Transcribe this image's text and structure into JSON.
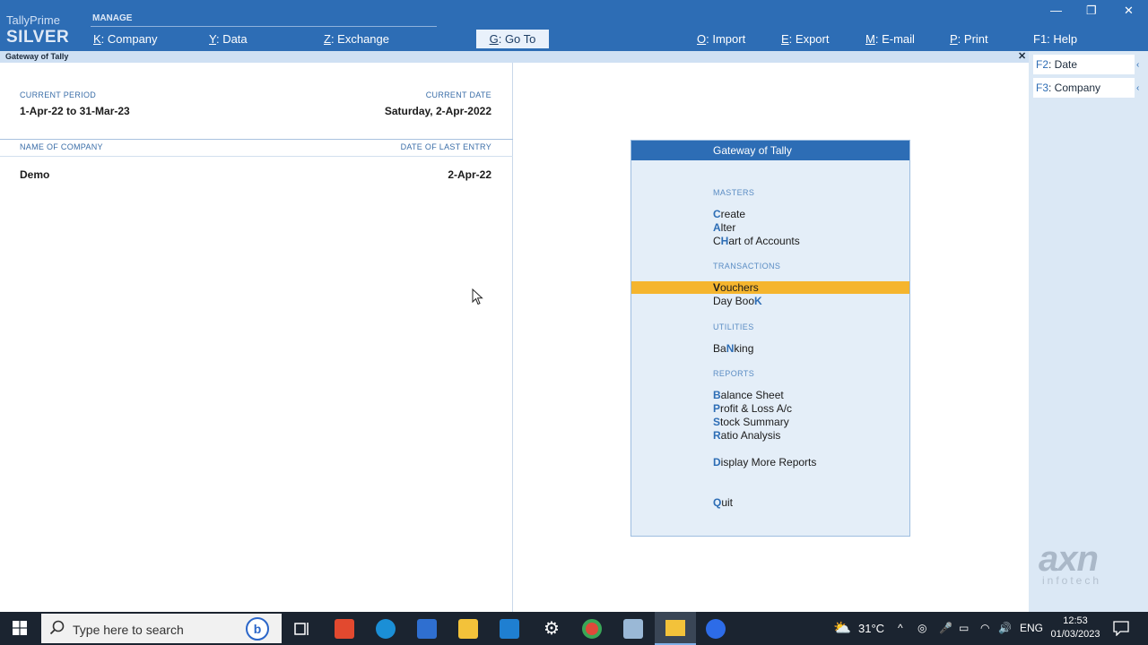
{
  "brand": {
    "product": "TallyPrime",
    "edition": "SILVER"
  },
  "topbar": {
    "manage_label": "MANAGE",
    "menu": [
      {
        "key": "K",
        "label": ": Company"
      },
      {
        "key": "Y",
        "label": ": Data"
      },
      {
        "key": "Z",
        "label": ": Exchange"
      }
    ],
    "goto": {
      "key": "G",
      "label": ": Go To"
    },
    "right_menu": [
      {
        "key": "O",
        "label": ": Import"
      },
      {
        "key": "E",
        "label": ": Export"
      },
      {
        "key": "M",
        "label": ": E-mail"
      },
      {
        "key": "P",
        "label": ": Print"
      },
      {
        "key": "F1",
        "label": ": Help"
      }
    ],
    "window_controls": {
      "minimize": "—",
      "restore": "❐",
      "close": "✕"
    }
  },
  "titlestrip": {
    "title": "Gateway of Tally",
    "close": "✕"
  },
  "info": {
    "current_period_label": "CURRENT PERIOD",
    "current_period": "1-Apr-22 to 31-Mar-23",
    "current_date_label": "CURRENT DATE",
    "current_date": "Saturday, 2-Apr-2022",
    "name_of_company_label": "NAME OF COMPANY",
    "date_of_last_entry_label": "DATE OF LAST ENTRY",
    "company_name": "Demo",
    "last_entry": "2-Apr-22"
  },
  "side_buttons": [
    {
      "key": "F2",
      "label": ": Date"
    },
    {
      "key": "F3",
      "label": ": Company"
    }
  ],
  "gateway": {
    "title": "Gateway of Tally",
    "sections": {
      "masters": "MASTERS",
      "transactions": "TRANSACTIONS",
      "utilities": "UTILITIES",
      "reports": "REPORTS"
    },
    "items": {
      "create": {
        "pre": "",
        "hk": "C",
        "post": "reate"
      },
      "alter": {
        "pre": "",
        "hk": "A",
        "post": "lter"
      },
      "chart": {
        "pre": "C",
        "hk": "H",
        "post": "art of Accounts"
      },
      "vouchers": {
        "pre": "",
        "hk": "V",
        "post": "ouchers"
      },
      "daybook": {
        "pre": "Day Boo",
        "hk": "K",
        "post": ""
      },
      "banking": {
        "pre": "Ba",
        "hk": "N",
        "post": "king"
      },
      "balance": {
        "pre": "",
        "hk": "B",
        "post": "alance Sheet"
      },
      "profit": {
        "pre": "",
        "hk": "P",
        "post": "rofit & Loss A/c"
      },
      "stock": {
        "pre": "",
        "hk": "S",
        "post": "tock Summary"
      },
      "ratio": {
        "pre": "",
        "hk": "R",
        "post": "atio Analysis"
      },
      "display": {
        "pre": "",
        "hk": "D",
        "post": "isplay More Reports"
      },
      "quit": {
        "pre": "",
        "hk": "Q",
        "post": "uit"
      }
    },
    "selected": "Vouchers"
  },
  "watermark": {
    "logo": "axn",
    "sub": "infotech"
  },
  "taskbar": {
    "search_placeholder": "Type here to search",
    "bing": "b",
    "weather": "31°C",
    "language": "ENG",
    "time": "12:53",
    "date": "01/03/2023"
  }
}
